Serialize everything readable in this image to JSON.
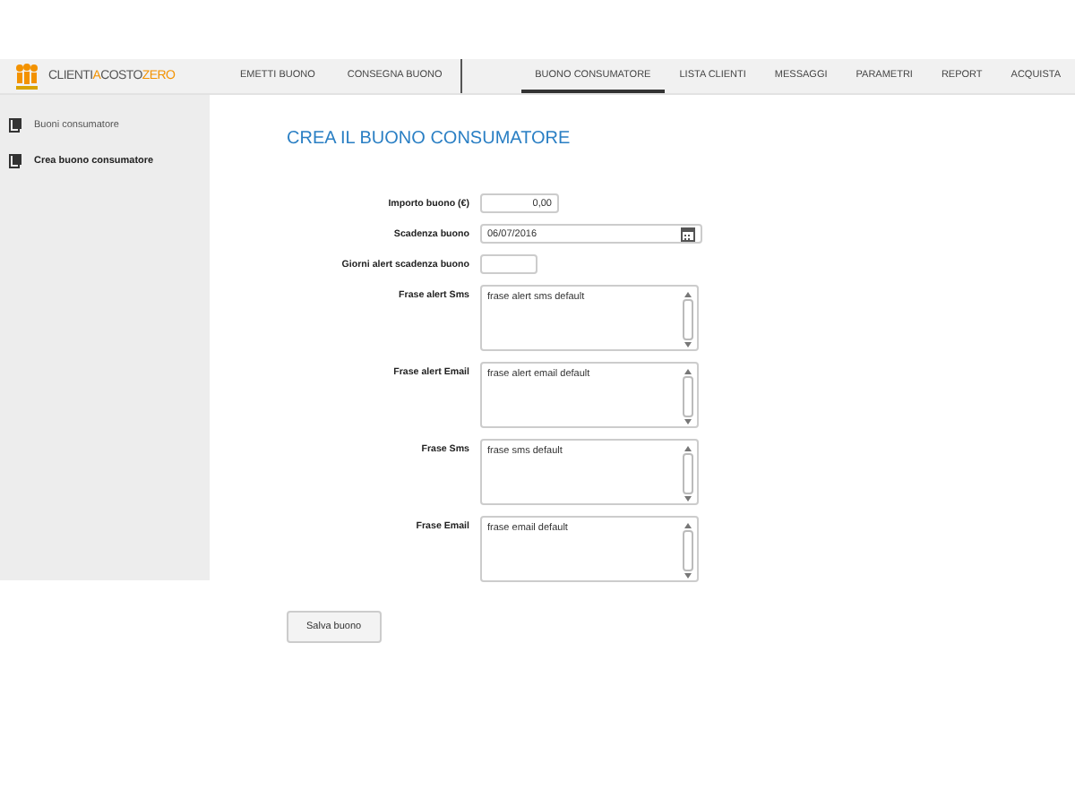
{
  "logo": {
    "parts": [
      {
        "text": "CLIENTI",
        "accent": false
      },
      {
        "text": "A",
        "accent": true
      },
      {
        "text": "COSTO",
        "accent": false
      },
      {
        "text": "ZERO",
        "accent": true
      }
    ]
  },
  "nav_left": [
    {
      "label": "EMETTI BUONO",
      "selected": false
    },
    {
      "label": "CONSEGNA BUONO",
      "selected": false
    }
  ],
  "nav_right": [
    {
      "label": "BUONO CONSUMATORE",
      "selected": true
    },
    {
      "label": "LISTA CLIENTI",
      "selected": false
    },
    {
      "label": "MESSAGGI",
      "selected": false
    },
    {
      "label": "PARAMETRI",
      "selected": false
    },
    {
      "label": "REPORT",
      "selected": false
    },
    {
      "label": "ACQUISTA",
      "selected": false
    }
  ],
  "sidebar": {
    "items": [
      {
        "label": "Buoni consumatore",
        "selected": false
      },
      {
        "label": "Crea buono consumatore",
        "selected": true
      }
    ]
  },
  "title": "CREA IL BUONO CONSUMATORE",
  "fields": [
    {
      "kind": "number",
      "label": "Importo buono (€)",
      "value": "0,00"
    },
    {
      "kind": "date",
      "label": "Scadenza buono",
      "value": "06/07/2016"
    },
    {
      "kind": "short",
      "label": "Giorni alert scadenza buono"
    },
    {
      "kind": "textarea",
      "label": "Frase alert Sms",
      "value": "frase alert sms default"
    },
    {
      "kind": "textarea",
      "label": "Frase alert Email",
      "value": "frase alert email default"
    },
    {
      "kind": "textarea",
      "label": "Frase Sms",
      "value": "frase sms default"
    },
    {
      "kind": "textarea",
      "label": "Frase Email",
      "value": "frase email default"
    }
  ],
  "save_button": "Salva buono"
}
